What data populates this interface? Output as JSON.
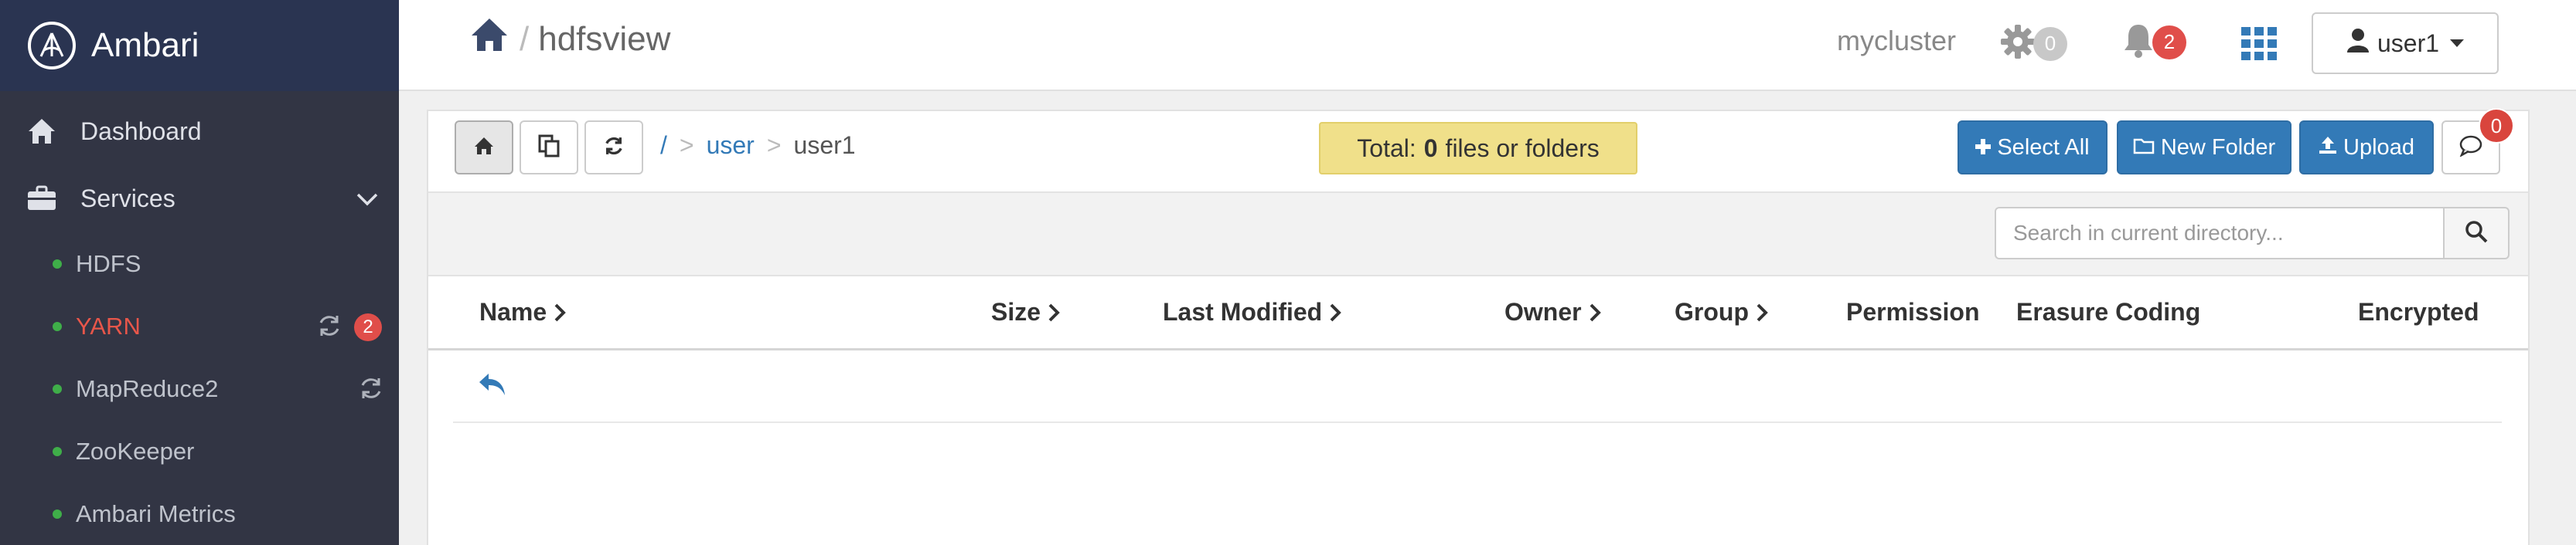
{
  "app": {
    "name": "Ambari"
  },
  "sidebar": {
    "dashboard": "Dashboard",
    "services": "Services",
    "items": [
      {
        "name": "HDFS",
        "alert": false,
        "refresh": false,
        "badge": ""
      },
      {
        "name": "YARN",
        "alert": true,
        "refresh": true,
        "badge": "2"
      },
      {
        "name": "MapReduce2",
        "alert": false,
        "refresh": true,
        "badge": ""
      },
      {
        "name": "ZooKeeper",
        "alert": false,
        "refresh": false,
        "badge": ""
      },
      {
        "name": "Ambari Metrics",
        "alert": false,
        "refresh": false,
        "badge": ""
      }
    ]
  },
  "topbar": {
    "separator": "/",
    "view_name": "hdfsview",
    "cluster": "mycluster",
    "ops_count": "0",
    "alerts_count": "2",
    "user": "user1"
  },
  "toolbar": {
    "path_root": "/",
    "path_sep": ">",
    "path_segments": [
      "user",
      "user1"
    ],
    "total_prefix": "Total:",
    "total_count": "0",
    "total_suffix": "files or folders",
    "select_all": "Select All",
    "new_folder": "New Folder",
    "upload": "Upload",
    "messages_count": "0"
  },
  "search": {
    "placeholder": "Search in current directory..."
  },
  "table": {
    "columns": [
      "Name",
      "Size",
      "Last Modified",
      "Owner",
      "Group",
      "Permission",
      "Erasure Coding",
      "Encrypted"
    ]
  },
  "colors": {
    "sidebar": "#323544",
    "logo_bg": "#2a3451",
    "primary": "#337ab7",
    "badge_red": "#e04e4a",
    "total_bg": "#f0e08a",
    "status_ok": "#3fae49"
  }
}
